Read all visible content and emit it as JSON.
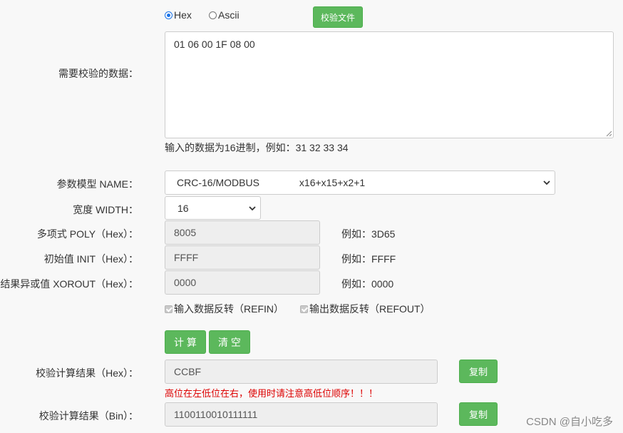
{
  "format": {
    "hex_label": "Hex",
    "ascii_label": "Ascii",
    "selected": "Hex"
  },
  "verify_button": "校验文件",
  "data_label": "需要校验的数据：",
  "data_value": "01 06 00 1F 08 00",
  "data_hint": "输入的数据为16进制，例如：31 32 33 34",
  "model": {
    "label": "参数模型 NAME：",
    "name": "CRC-16/MODBUS",
    "poly_expr": "x16+x15+x2+1"
  },
  "width": {
    "label": "宽度 WIDTH：",
    "value": "16"
  },
  "poly": {
    "label": "多项式 POLY（Hex）：",
    "value": "8005",
    "example": "例如：3D65"
  },
  "init": {
    "label": "初始值 INIT（Hex）：",
    "value": "FFFF",
    "example": "例如：FFFF"
  },
  "xorout": {
    "label": "结果异或值 XOROUT（Hex）：",
    "value": "0000",
    "example": "例如：0000"
  },
  "refin_label": "输入数据反转（REFIN）",
  "refout_label": "输出数据反转（REFOUT）",
  "calc_button": "计 算",
  "clear_button": "清 空",
  "result_hex": {
    "label": "校验计算结果（Hex）：",
    "value": "CCBF",
    "copy": "复制"
  },
  "warning": "高位在左低位在右，使用时请注意高低位顺序！！！",
  "result_bin": {
    "label": "校验计算结果（Bin）：",
    "value": "1100110010111111",
    "copy": "复制"
  },
  "watermark": "CSDN @自小吃多",
  "colors": {
    "green": "#5cb85c",
    "warning_red": "#dd0000",
    "radio_blue": "#1a73e8"
  }
}
